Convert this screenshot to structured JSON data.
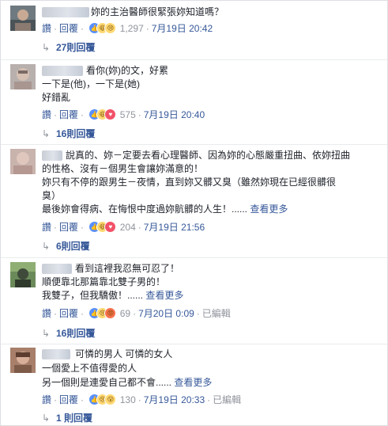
{
  "comments": [
    {
      "text_lines": [
        "妳的主治醫師很緊張妳知道嗎？"
      ],
      "actions": {
        "like": "讚",
        "reply": "回覆"
      },
      "reaction_count": "1,297",
      "timestamp": "7月19日 20:42",
      "replies_label": "27則回覆",
      "reactions": [
        "like",
        "haha",
        "sad"
      ]
    },
    {
      "text_lines": [
        "看你(妳)的文，好累",
        "一下是(他)，一下是(她)",
        "好錯亂"
      ],
      "actions": {
        "like": "讚",
        "reply": "回覆"
      },
      "reaction_count": "575",
      "timestamp": "7月19日 20:40",
      "replies_label": "16則回覆",
      "reactions": [
        "like",
        "haha",
        "love"
      ]
    },
    {
      "text_lines": [
        "說真的、妳－定要去看心理醫師、因為妳的心態嚴重扭曲、依妳扭曲",
        "的性格、沒有－個男生會讓妳滿意的！",
        "妳只有不停的跟男生－夜情，直到妳又髒又臭（雖然妳現在已經很髒很",
        "臭）",
        "最後妳會得病、在悔恨中度過妳骯髒的人生！......"
      ],
      "see_more": "查看更多",
      "actions": {
        "like": "讚",
        "reply": "回覆"
      },
      "reaction_count": "204",
      "timestamp": "7月19日 21:56",
      "replies_label": "6則回覆",
      "reactions": [
        "like",
        "haha",
        "love"
      ]
    },
    {
      "text_lines": [
        "看到這裡我忍無可忍了！",
        "順便靠北那篇靠北雙子男的！",
        "我雙子，但我驕傲！......"
      ],
      "see_more": "查看更多",
      "actions": {
        "like": "讚",
        "reply": "回覆"
      },
      "reaction_count": "69",
      "timestamp": "7月20日 0:09",
      "edited": "已編輯",
      "replies_label": "16則回覆",
      "reactions": [
        "like",
        "sad",
        "angry"
      ]
    },
    {
      "text_lines": [
        "可憐的男人 可憐的女人",
        "一個愛上不值得愛的人",
        "另一個則是連愛自己都不會......"
      ],
      "see_more": "查看更多",
      "actions": {
        "like": "讚",
        "reply": "回覆"
      },
      "reaction_count": "130",
      "timestamp": "7月19日 20:33",
      "edited": "已編輯",
      "replies_label": "1 則回覆",
      "reactions": [
        "like",
        "sad",
        "wow"
      ]
    }
  ],
  "colors": {
    "link": "#365899",
    "meta": "#90949c",
    "text": "#1d2129",
    "divider": "#e9ebee",
    "like": "#5890ff",
    "love": "#f25268",
    "haha": "#ffd972",
    "angry": "#f7714c"
  },
  "icons": {
    "reply_arrow": "reply-arrow-icon"
  }
}
